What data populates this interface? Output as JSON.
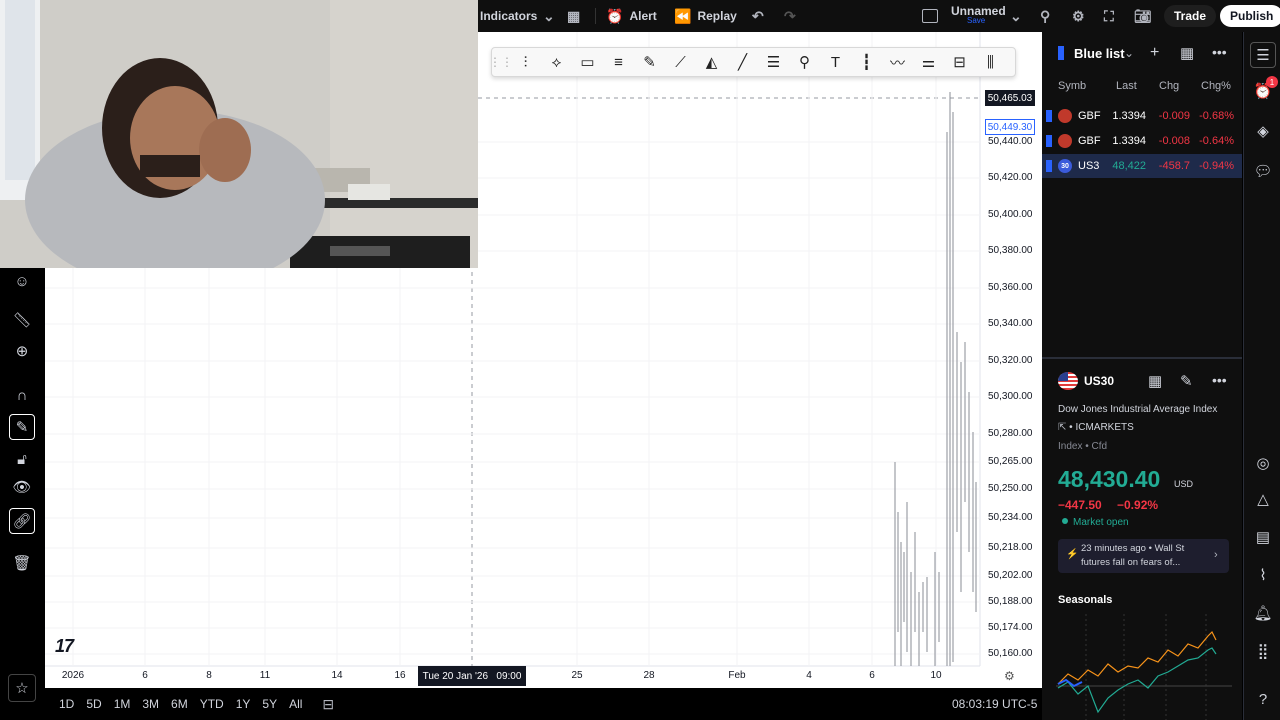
{
  "topbar": {
    "indicators": "Indicators",
    "alert": "Alert",
    "replay": "Replay",
    "layout_name": "Unnamed",
    "layout_sub": "Save",
    "trade": "Trade",
    "publish": "Publish"
  },
  "chart": {
    "price_labels": [
      "50,440.00",
      "50,420.00",
      "50,400.00",
      "50,380.00",
      "50,360.00",
      "50,340.00",
      "50,320.00",
      "50,300.00",
      "50,280.00",
      "50,265.00",
      "50,250.00",
      "50,234.00",
      "50,218.00",
      "50,202.00",
      "50,188.00",
      "50,174.00",
      "50,160.00"
    ],
    "crosshair_price": "50,465.03",
    "last_price_tag": "50,449.30",
    "time_labels": [
      "2026",
      "6",
      "8",
      "11",
      "14",
      "16",
      "25",
      "28",
      "Feb",
      "4",
      "6",
      "10"
    ],
    "crosshair_time": "Tue 20 Jan '26   09:00",
    "logo": "17"
  },
  "bottombar": {
    "ranges": [
      "1D",
      "5D",
      "1M",
      "3M",
      "6M",
      "YTD",
      "1Y",
      "5Y",
      "All"
    ],
    "clock": "08:03:19 UTC-5"
  },
  "watchlist": {
    "title": "Blue list",
    "columns": [
      "Symb",
      "Last",
      "Chg",
      "Chg%"
    ],
    "rows": [
      {
        "symbol": "GBF",
        "last": "1.3394",
        "chg": "-0.009",
        "chg_pct": "-0.68%",
        "flag": ""
      },
      {
        "symbol": "GBF",
        "last": "1.3394",
        "chg": "-0.008",
        "chg_pct": "-0.64%",
        "flag": ""
      },
      {
        "symbol": "US3",
        "last": "48,422",
        "chg": "-458.7",
        "chg_pct": "-0.94%",
        "flag": "30"
      }
    ]
  },
  "details": {
    "symbol": "US30",
    "name": "Dow Jones Industrial Average Index",
    "exchange": "ICMARKETS",
    "type": "Index • Cfd",
    "price": "48,430.40",
    "currency": "USD",
    "change": "−447.50",
    "change_pct": "−0.92%",
    "status": "Market open",
    "news_time": "23 minutes ago",
    "news_source": "Wall St",
    "news_text": "futures fall on fears of...",
    "seasonals": "Seasonals"
  },
  "badges": {
    "alerts_count": "1"
  },
  "colors": {
    "red": "#f23645",
    "green": "#22ab94",
    "accent": "#2962ff"
  }
}
